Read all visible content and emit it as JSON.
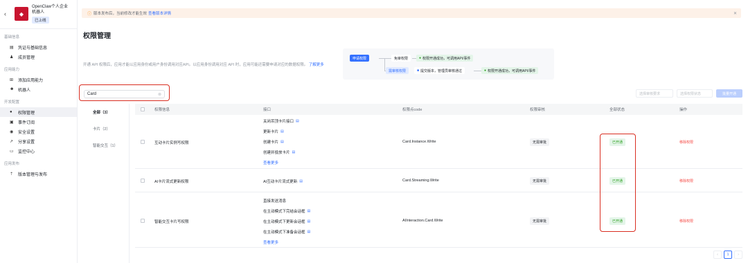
{
  "app": {
    "name_line1": "OpenClaw个人企业",
    "name_line2": "机器人",
    "badge": "已上线"
  },
  "sidebar": {
    "groups": [
      {
        "label": "基础信息",
        "items": [
          {
            "label": "凭证与基础信息"
          },
          {
            "label": "成员管理"
          }
        ]
      },
      {
        "label": "应用能力",
        "items": [
          {
            "label": "添加应用能力"
          },
          {
            "label": "机器人"
          }
        ]
      },
      {
        "label": "开发配置",
        "items": [
          {
            "label": "权限管理"
          },
          {
            "label": "事件订阅"
          },
          {
            "label": "安全设置"
          },
          {
            "label": "分享设置"
          },
          {
            "label": "监控中心"
          }
        ]
      },
      {
        "label": "应用发布",
        "items": [
          {
            "label": "版本管理与发布"
          }
        ]
      }
    ]
  },
  "banner": {
    "text": "版本发布后，当前修改才能生效",
    "link": "查看版本详情"
  },
  "page": {
    "title": "权限管理",
    "description": "开通 API 权限后，应用才能以应用身份或用户身份调用对应API。以应用身份调用对应 API 时，应用可能还需要申请对应的数据权限。",
    "learn_more": "了解更多"
  },
  "flow": {
    "apply": "申请权限",
    "free": "免审权限",
    "free_ok": "权限开通成功，可调用API/事件",
    "review": "需审核权限",
    "submit": "提交版本，管理员审核通过",
    "review_ok": "权限开通成功，可调用API/事件"
  },
  "search": {
    "value": "Card"
  },
  "filters": {
    "review_placeholder": "选择审核要求",
    "status_placeholder": "选择权限状态",
    "batch_label": "批量开通"
  },
  "categories": [
    {
      "label": "全部（3）"
    },
    {
      "label": "卡片（2）"
    },
    {
      "label": "智能交互（1）"
    }
  ],
  "table": {
    "headers": {
      "name": "权限信息",
      "api": "接口",
      "code": "权限点code",
      "review": "权限审核",
      "status": "全部状态",
      "action": "操作"
    },
    "rows": [
      {
        "name": "互动卡片实例写权限",
        "apis": [
          "关闭吊顶卡片接口",
          "更新卡片",
          "创建卡片",
          "创建并投放卡片"
        ],
        "view_more": "查看更多",
        "code": "Card.Instance.Write",
        "review": "无需审批",
        "status": "已开通",
        "action": "移除权限"
      },
      {
        "name": "AI卡片流式更新权限",
        "apis": [
          "AI互动卡片流式更新"
        ],
        "view_more": "",
        "code": "Card.Streaming.Write",
        "review": "无需审批",
        "status": "已开通",
        "action": "移除权限"
      },
      {
        "name": "智能交互卡片写权限",
        "apis": [
          "直接发送消息",
          "在主动模式下完结会话框",
          "在主动模式下更新会话框",
          "在主动模式下准备会话框"
        ],
        "view_more": "查看更多",
        "code": "AIInteraction.Card.Write",
        "review": "无需审批",
        "status": "已开通",
        "action": "移除权限"
      }
    ]
  },
  "pagination": {
    "current": "1"
  }
}
